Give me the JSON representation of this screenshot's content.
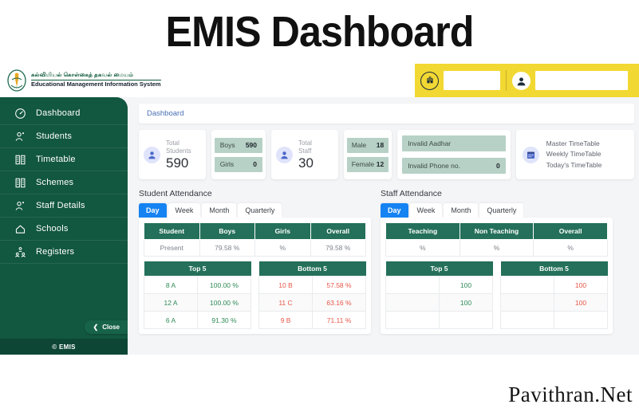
{
  "title": "EMIS Dashboard",
  "watermark": "Pavithran.Net",
  "brand": {
    "tamil": "கல்வியியல் கொள்கைத் தகவல் மையம்",
    "english": "Educational Management Information System",
    "logo_icon": "tamilnadu-emblem-icon"
  },
  "topbar": {
    "school_icon": "school-building-icon",
    "school_value": "",
    "school_placeholder": "",
    "user_icon": "user-avatar-icon",
    "user_value": "",
    "user_placeholder": ""
  },
  "sidebar": {
    "items": [
      {
        "label": "Dashboard",
        "icon": "speedometer-icon"
      },
      {
        "label": "Students",
        "icon": "student-icon"
      },
      {
        "label": "Timetable",
        "icon": "timetable-book-icon"
      },
      {
        "label": "Schemes",
        "icon": "schemes-book-icon"
      },
      {
        "label": "Staff Details",
        "icon": "staff-icon"
      },
      {
        "label": "Schools",
        "icon": "home-icon"
      },
      {
        "label": "Registers",
        "icon": "registers-people-icon"
      }
    ],
    "close_label": "Close",
    "close_icon": "chevron-left-icon",
    "footer": "© EMIS"
  },
  "breadcrumb": "Dashboard",
  "stats": {
    "students": {
      "icon": "person-avatar-icon",
      "label_line1": "Total",
      "label_line2": "Students",
      "value": "590",
      "breakdown": [
        {
          "label": "Boys",
          "value": "590"
        },
        {
          "label": "Girls",
          "value": "0"
        }
      ]
    },
    "staff": {
      "icon": "person-avatar-icon",
      "label_line1": "Total",
      "label_line2": "Staff",
      "value": "30",
      "breakdown": [
        {
          "label": "Male",
          "value": "18"
        },
        {
          "label": "Female",
          "value": "12"
        }
      ]
    },
    "invalid": [
      {
        "label": "Invalid Aadhar",
        "value": ""
      },
      {
        "label": "Invalid Phone no.",
        "value": "0"
      }
    ],
    "timetable": {
      "icon": "calendar-icon",
      "links": [
        "Master TimeTable",
        "Weekly TimeTable",
        "Today's TimeTable"
      ]
    }
  },
  "student_attendance": {
    "title": "Student Attendance",
    "tabs": [
      "Day",
      "Week",
      "Month",
      "Quarterly"
    ],
    "active_tab": "Day",
    "headers": [
      "Student",
      "Boys",
      "Girls",
      "Overall"
    ],
    "row": [
      "Present",
      "79.58 %",
      "%",
      "79.58 %"
    ],
    "top5_title": "Top 5",
    "top5": [
      {
        "name": "8 A",
        "value": "100.00 %"
      },
      {
        "name": "12 A",
        "value": "100.00 %"
      },
      {
        "name": "6 A",
        "value": "91.30 %"
      }
    ],
    "bottom5_title": "Bottom 5",
    "bottom5": [
      {
        "name": "10 B",
        "value": "57.58 %"
      },
      {
        "name": "11 C",
        "value": "63.16 %"
      },
      {
        "name": "9 B",
        "value": "71.11 %"
      }
    ]
  },
  "staff_attendance": {
    "title": "Staff Attendance",
    "tabs": [
      "Day",
      "Week",
      "Month",
      "Quarterly"
    ],
    "active_tab": "Day",
    "headers": [
      "Teaching",
      "Non Teaching",
      "Overall"
    ],
    "row": [
      "%",
      "%",
      "%"
    ],
    "top5_title": "Top 5",
    "top5": [
      {
        "name": "",
        "value": "100"
      },
      {
        "name": "",
        "value": "100"
      },
      {
        "name": "",
        "value": ""
      }
    ],
    "bottom5_title": "Bottom 5",
    "bottom5": [
      {
        "name": "",
        "value": "100"
      },
      {
        "name": "",
        "value": "100"
      },
      {
        "name": "",
        "value": ""
      }
    ]
  },
  "colors": {
    "sidebar_green": "#125740",
    "table_header_green": "#24705a",
    "accent_blue": "#1583f2",
    "header_yellow": "#f2d832",
    "pill_green": "#b7d1c6",
    "good": "#2e8b57",
    "bad": "#e8574a"
  }
}
